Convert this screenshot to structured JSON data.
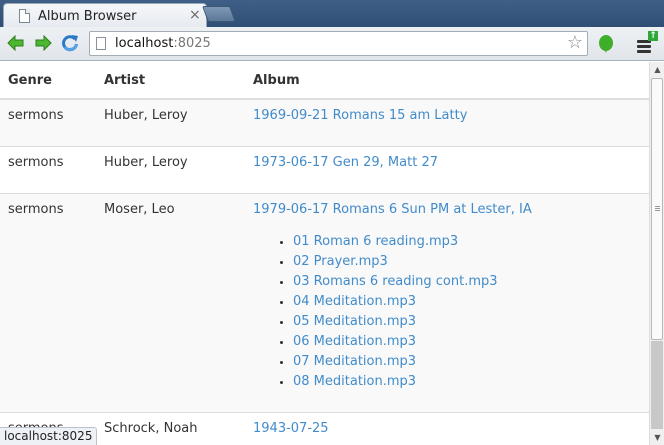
{
  "browser": {
    "tab_title": "Album Browser",
    "tab_close": "×",
    "url_host": "localhost",
    "url_port": ":8025",
    "status_url": "localhost:8025"
  },
  "table": {
    "headers": {
      "genre": "Genre",
      "artist": "Artist",
      "album": "Album"
    },
    "rows": [
      {
        "genre": "sermons",
        "artist": "Huber, Leroy",
        "album": "1969-09-21 Romans 15 am Latty"
      },
      {
        "genre": "sermons",
        "artist": "Huber, Leroy",
        "album": "1973-06-17 Gen 29, Matt 27"
      },
      {
        "genre": "sermons",
        "artist": "Moser, Leo",
        "album": "1979-06-17 Romans 6 Sun PM at Lester, IA",
        "tracks": [
          "01 Roman 6 reading.mp3",
          "02 Prayer.mp3",
          "03 Romans 6 reading cont.mp3",
          "04 Meditation.mp3",
          "05 Meditation.mp3",
          "06 Meditation.mp3",
          "07 Meditation.mp3",
          "08 Meditation.mp3"
        ]
      },
      {
        "genre": "sermons",
        "artist": "Schrock, Noah",
        "album": "1943-07-25"
      }
    ]
  },
  "icons": {
    "back": "arrow-left-icon",
    "forward": "arrow-right-icon",
    "reload": "reload-icon",
    "bookmark": "star-icon",
    "extension": "evernote-icon",
    "menu": "menu-icon"
  },
  "colors": {
    "link": "#428bca",
    "nav_arrow": "#3fae2a",
    "reload": "#2a78c8"
  }
}
